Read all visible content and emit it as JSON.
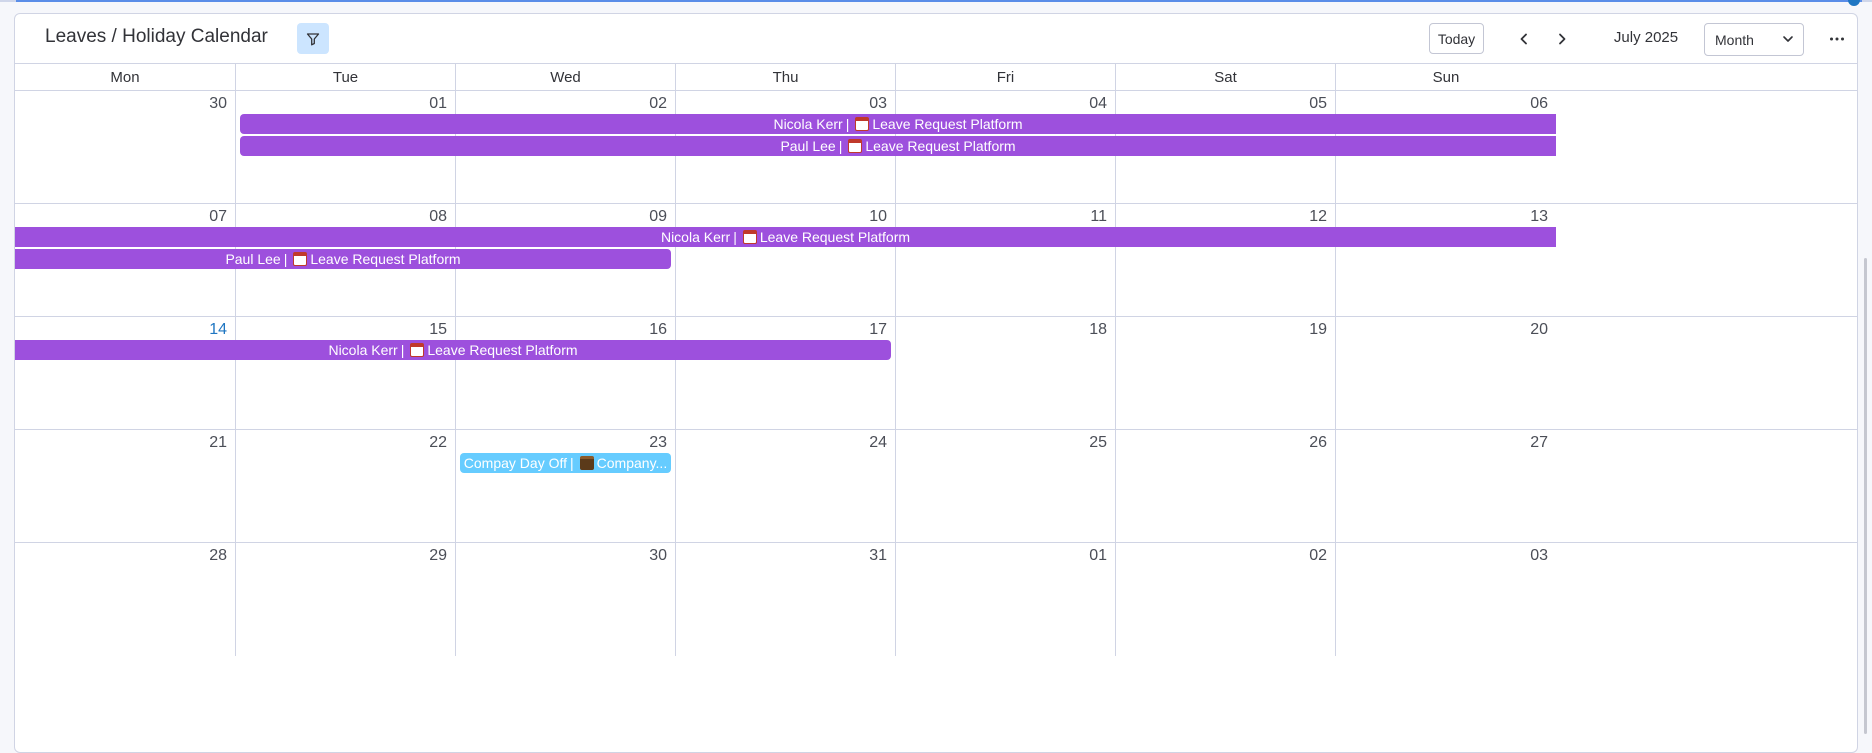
{
  "header": {
    "title": "Leaves / Holiday Calendar",
    "today_label": "Today",
    "period_label": "July 2025",
    "view_select": "Month"
  },
  "days_of_week": [
    "Mon",
    "Tue",
    "Wed",
    "Thu",
    "Fri",
    "Sat",
    "Sun"
  ],
  "weeks": [
    {
      "days": [
        "30",
        "01",
        "02",
        "03",
        "04",
        "05",
        "06"
      ]
    },
    {
      "days": [
        "07",
        "08",
        "09",
        "10",
        "11",
        "12",
        "13"
      ]
    },
    {
      "days": [
        "14",
        "15",
        "16",
        "17",
        "18",
        "19",
        "20"
      ]
    },
    {
      "days": [
        "21",
        "22",
        "23",
        "24",
        "25",
        "26",
        "27"
      ]
    },
    {
      "days": [
        "28",
        "29",
        "30",
        "31",
        "01",
        "02",
        "03"
      ]
    }
  ],
  "today_date": "14",
  "events": [
    {
      "name": "Nicola Kerr",
      "separator": "|",
      "source": "Leave Request Platform",
      "icon": "calendar-icon"
    },
    {
      "name": "Paul Lee",
      "separator": "|",
      "source": "Leave Request Platform",
      "icon": "calendar-icon"
    },
    {
      "name": "Nicola Kerr",
      "separator": "|",
      "source": "Leave Request Platform",
      "icon": "calendar-icon"
    },
    {
      "name": "Paul Lee",
      "separator": "|",
      "source": "Leave Request Platform",
      "icon": "calendar-icon"
    },
    {
      "name": "Nicola Kerr",
      "separator": "|",
      "source": "Leave Request Platform",
      "icon": "calendar-icon"
    },
    {
      "name": "Compay Day Off",
      "separator": "|",
      "source": "Company...",
      "icon": "briefcase-icon"
    }
  ],
  "colors": {
    "leave_event": "#9d50dd",
    "company_event": "#66ccff",
    "today_number": "#1f76c2",
    "filter_active_bg": "#cce5ff"
  }
}
